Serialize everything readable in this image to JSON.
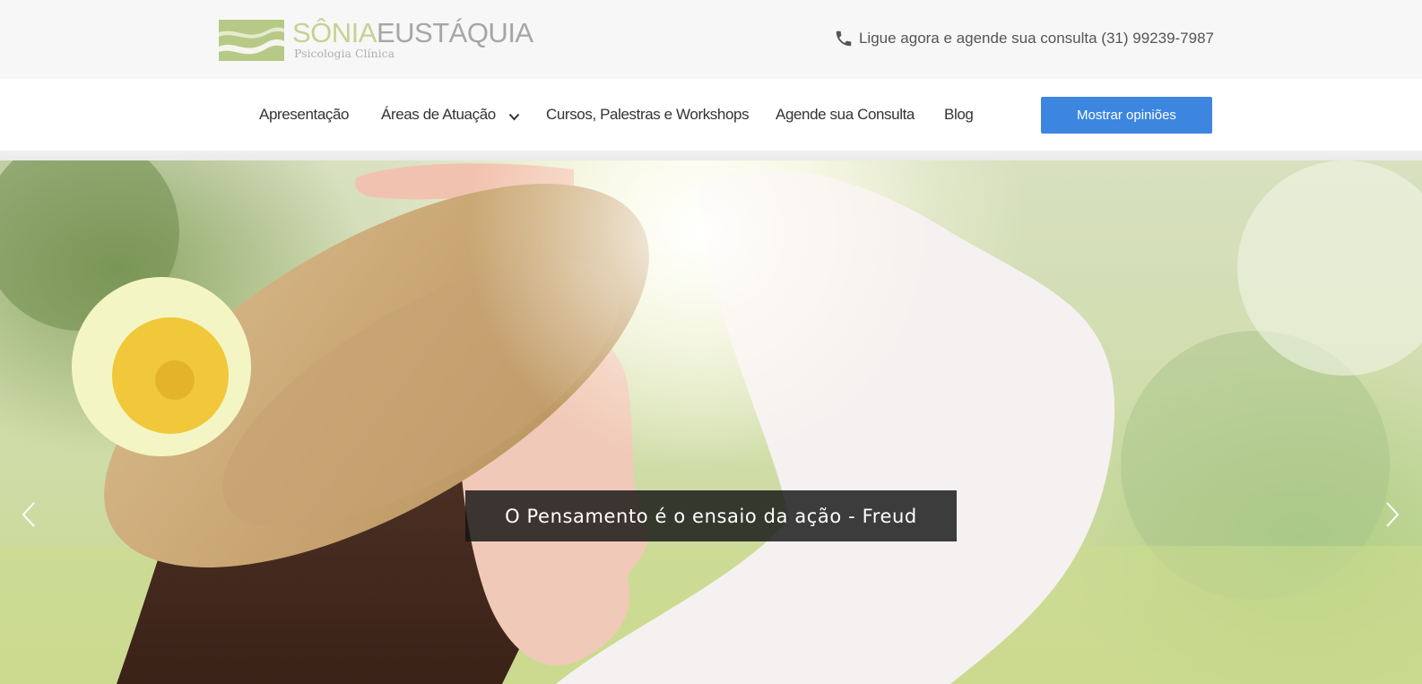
{
  "header": {
    "logo": {
      "first_name": "SÔNIA",
      "last_name": "EUSTÁQUIA",
      "subtitle": "Psicologia Clínica"
    },
    "phone": {
      "icon": "phone-icon",
      "text": "Ligue agora e agende sua consulta (31) 99239-7987"
    }
  },
  "nav": {
    "items": [
      {
        "label": "Apresentação"
      },
      {
        "label": "Áreas de Atuação",
        "has_dropdown": true
      },
      {
        "label": "Cursos, Palestras e Workshops"
      },
      {
        "label": "Agende sua Consulta"
      },
      {
        "label": "Blog"
      }
    ],
    "button_label": "Mostrar opiniões"
  },
  "hero": {
    "caption": "O Pensamento é o ensaio da ação - Freud",
    "prev_icon": "chevron-left-icon",
    "next_icon": "chevron-right-icon"
  },
  "colors": {
    "logo_green": "#c3d392",
    "logo_gray": "#a6a6a6",
    "button_blue": "#3d86e0",
    "topbar_bg": "#f7f7f7"
  }
}
